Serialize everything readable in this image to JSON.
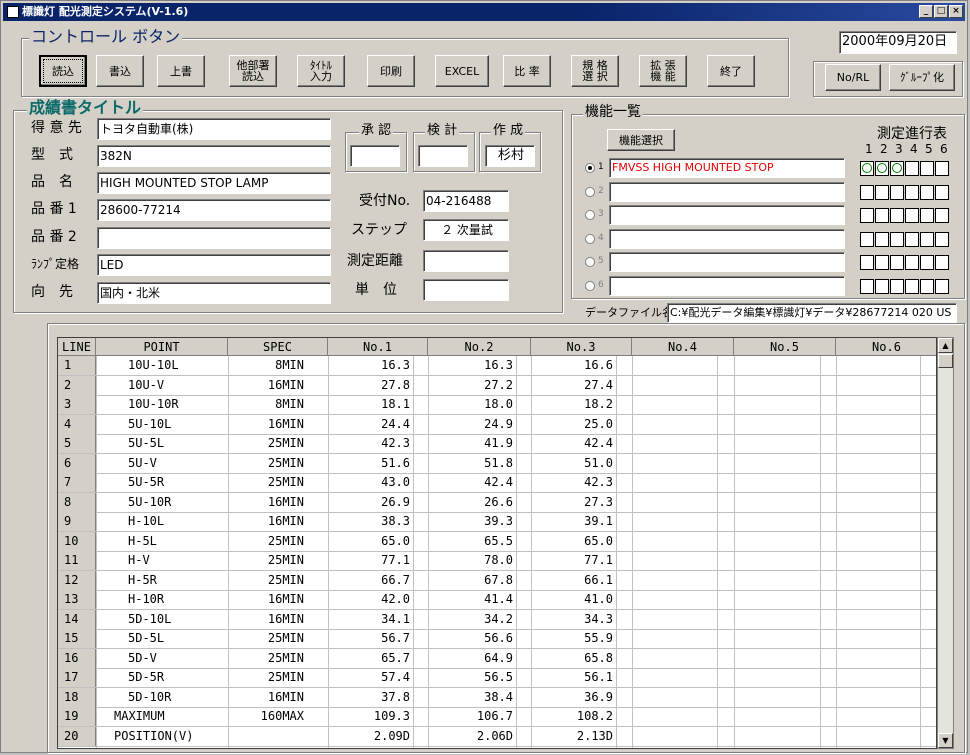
{
  "window": {
    "title": "標識灯 配光測定システム(V-1.6)",
    "minimize": "_",
    "maximize": "□",
    "close": "×"
  },
  "date": "2000年09月20日",
  "control": {
    "group_label": "コントロール ボタン",
    "buttons": [
      {
        "label": "読込"
      },
      {
        "label": "書込"
      },
      {
        "label": "上書"
      },
      {
        "label": "他部署\n読込"
      },
      {
        "label": "ﾀｲﾄﾙ\n入力"
      },
      {
        "label": "印刷"
      },
      {
        "label": "EXCEL"
      },
      {
        "label": "比 率"
      },
      {
        "label": "規 格\n選 択"
      },
      {
        "label": "拡 張\n機 能"
      },
      {
        "label": "終了"
      }
    ]
  },
  "right_buttons": {
    "no_rl": "No/RL",
    "group": "ｸﾞﾙｰﾌﾟ化"
  },
  "report": {
    "group_label": "成績書タイトル",
    "fields": [
      {
        "label": "得 意 先",
        "value": "トヨタ自動車(株)"
      },
      {
        "label": "型　式",
        "value": "382N"
      },
      {
        "label": "品　名",
        "value": "HIGH MOUNTED STOP LAMP"
      },
      {
        "label": "品 番 1",
        "value": "28600-77214"
      },
      {
        "label": "品 番 2",
        "value": ""
      },
      {
        "label": "ﾗﾝﾌﾟ定格",
        "value": "LED"
      },
      {
        "label": "向　先",
        "value": "国内・北米"
      }
    ],
    "approve": {
      "label": "承 認",
      "value": ""
    },
    "review": {
      "label": "検 計",
      "value": ""
    },
    "create": {
      "label": "作 成",
      "value": "杉村"
    },
    "receipt": {
      "label": "受付No.",
      "value": "04-216488"
    },
    "step": {
      "label": "ステップ",
      "value": "２ 次量試"
    },
    "distance": {
      "label": "測定距離",
      "value": ""
    },
    "unit": {
      "label": "単　位",
      "value": ""
    }
  },
  "functions": {
    "group_label": "機能一覧",
    "select_button": "機能選択",
    "progress_title": "測定進行表",
    "progress_cols": [
      "1",
      "2",
      "3",
      "4",
      "5",
      "6"
    ],
    "rows": [
      {
        "num": "1",
        "selected": true,
        "value": "FMVSS HIGH MOUNTED STOP",
        "progress": [
          true,
          true,
          true,
          false,
          false,
          false
        ]
      },
      {
        "num": "2",
        "selected": false,
        "value": "",
        "progress": [
          false,
          false,
          false,
          false,
          false,
          false
        ]
      },
      {
        "num": "3",
        "selected": false,
        "value": "",
        "progress": [
          false,
          false,
          false,
          false,
          false,
          false
        ]
      },
      {
        "num": "4",
        "selected": false,
        "value": "",
        "progress": [
          false,
          false,
          false,
          false,
          false,
          false
        ]
      },
      {
        "num": "5",
        "selected": false,
        "value": "",
        "progress": [
          false,
          false,
          false,
          false,
          false,
          false
        ]
      },
      {
        "num": "6",
        "selected": false,
        "value": "",
        "progress": [
          false,
          false,
          false,
          false,
          false,
          false
        ]
      }
    ]
  },
  "datafile": {
    "label": "データファイル名",
    "value": "C:¥配光データ編集¥標識灯¥データ¥28677214 020 US"
  },
  "table": {
    "headers": [
      "LINE",
      "POINT",
      "SPEC",
      "No.1",
      "No.2",
      "No.3",
      "No.4",
      "No.5",
      "No.6"
    ],
    "rows": [
      [
        "1",
        "10U-10L",
        "8MIN",
        "16.3",
        "16.3",
        "16.6"
      ],
      [
        "2",
        "10U-V",
        "16MIN",
        "27.8",
        "27.2",
        "27.4"
      ],
      [
        "3",
        "10U-10R",
        "8MIN",
        "18.1",
        "18.0",
        "18.2"
      ],
      [
        "4",
        "5U-10L",
        "16MIN",
        "24.4",
        "24.9",
        "25.0"
      ],
      [
        "5",
        "5U-5L",
        "25MIN",
        "42.3",
        "41.9",
        "42.4"
      ],
      [
        "6",
        "5U-V",
        "25MIN",
        "51.6",
        "51.8",
        "51.0"
      ],
      [
        "7",
        "5U-5R",
        "25MIN",
        "43.0",
        "42.4",
        "42.3"
      ],
      [
        "8",
        "5U-10R",
        "16MIN",
        "26.9",
        "26.6",
        "27.3"
      ],
      [
        "9",
        "H-10L",
        "16MIN",
        "38.3",
        "39.3",
        "39.1"
      ],
      [
        "10",
        "H-5L",
        "25MIN",
        "65.0",
        "65.5",
        "65.0"
      ],
      [
        "11",
        "H-V",
        "25MIN",
        "77.1",
        "78.0",
        "77.1"
      ],
      [
        "12",
        "H-5R",
        "25MIN",
        "66.7",
        "67.8",
        "66.1"
      ],
      [
        "13",
        "H-10R",
        "16MIN",
        "42.0",
        "41.4",
        "41.0"
      ],
      [
        "14",
        "5D-10L",
        "16MIN",
        "34.1",
        "34.2",
        "34.3"
      ],
      [
        "15",
        "5D-5L",
        "25MIN",
        "56.7",
        "56.6",
        "55.9"
      ],
      [
        "16",
        "5D-V",
        "25MIN",
        "65.7",
        "64.9",
        "65.8"
      ],
      [
        "17",
        "5D-5R",
        "25MIN",
        "57.4",
        "56.5",
        "56.1"
      ],
      [
        "18",
        "5D-10R",
        "16MIN",
        "37.8",
        "38.4",
        "36.9"
      ],
      [
        "19",
        "MAXIMUM",
        "160MAX",
        "109.3",
        "106.7",
        "108.2"
      ],
      [
        "20",
        "POSITION(V)",
        "",
        "2.09D",
        "2.06D",
        "2.13D"
      ]
    ]
  },
  "scroll": {
    "up": "▲",
    "down": "▼"
  }
}
